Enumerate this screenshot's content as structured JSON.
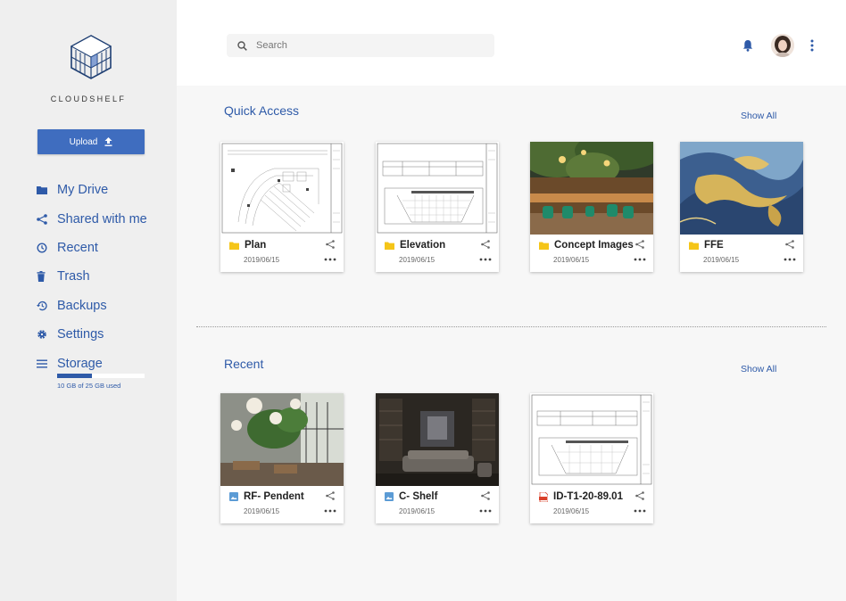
{
  "brand": {
    "name": "CLOUDSHELF"
  },
  "sidebar": {
    "upload_label": "Upload",
    "items": [
      {
        "label": "My Drive",
        "icon": "folder-icon"
      },
      {
        "label": "Shared with me",
        "icon": "share-icon"
      },
      {
        "label": "Recent",
        "icon": "clock-icon"
      },
      {
        "label": "Trash",
        "icon": "trash-icon"
      },
      {
        "label": "Backups",
        "icon": "history-icon"
      },
      {
        "label": "Settings",
        "icon": "gear-icon"
      },
      {
        "label": "Storage",
        "icon": "menu-icon"
      }
    ],
    "storage": {
      "used_text": "10 GB of 25 GB used",
      "used_fraction": 0.4
    }
  },
  "header": {
    "search_placeholder": "Search"
  },
  "quick_access": {
    "title": "Quick Access",
    "show_all": "Show All",
    "files": [
      {
        "name": "Plan",
        "date": "2019/06/15",
        "type": "folder"
      },
      {
        "name": "Elevation",
        "date": "2019/06/15",
        "type": "folder"
      },
      {
        "name": "Concept Images",
        "date": "2019/06/15",
        "type": "folder"
      },
      {
        "name": "FFE",
        "date": "2019/06/15",
        "type": "folder"
      }
    ]
  },
  "recent": {
    "title": "Recent",
    "show_all": "Show All",
    "files": [
      {
        "name": "RF- Pendent",
        "date": "2019/06/15",
        "type": "image"
      },
      {
        "name": "C- Shelf",
        "date": "2019/06/15",
        "type": "image"
      },
      {
        "name": "ID-T1-20-89.01",
        "date": "2019/06/15",
        "type": "pdf"
      }
    ]
  },
  "colors": {
    "accent": "#2e5aa8",
    "button": "#3f6dbf",
    "folder": "#f5c518",
    "image_icon": "#5b9bd5",
    "pdf_icon": "#d9412b"
  }
}
